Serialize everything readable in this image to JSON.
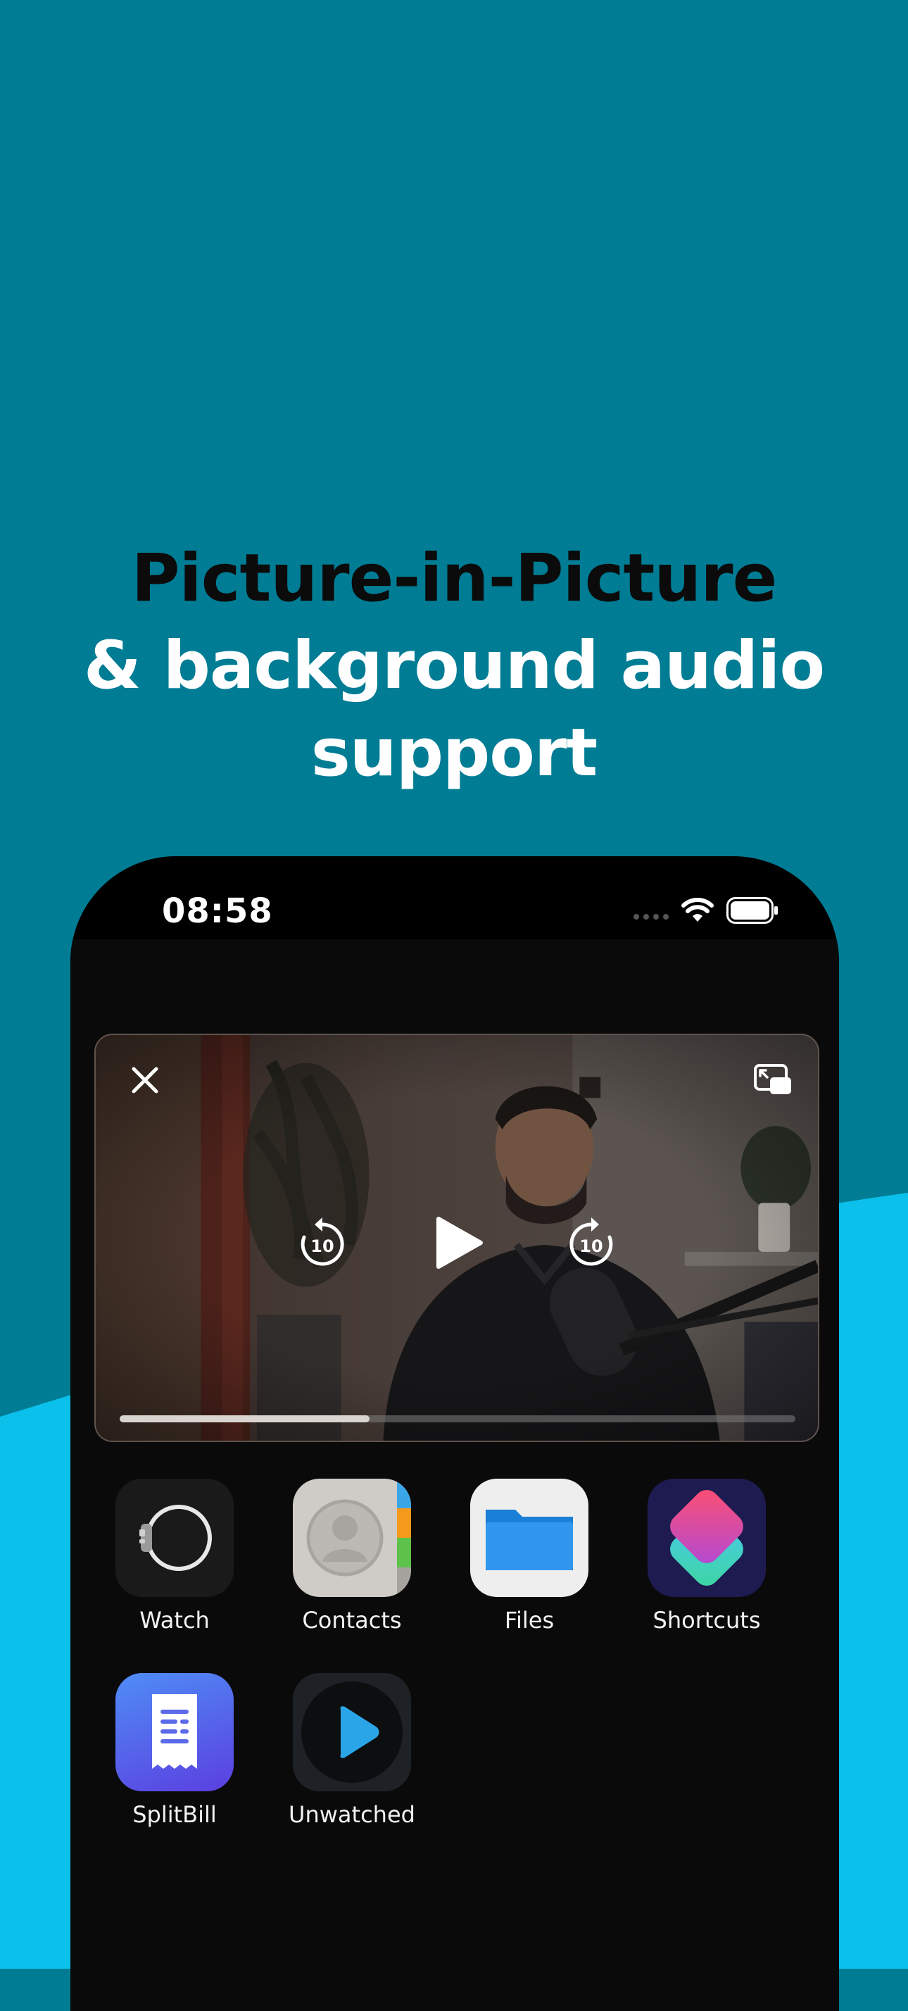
{
  "headline": {
    "line1": "Picture-in-Picture",
    "line2": "& background audio",
    "line3": "support"
  },
  "status_bar": {
    "time": "08:58",
    "icons": [
      "cellular-dots-icon",
      "wifi-icon",
      "battery-icon"
    ]
  },
  "player": {
    "controls": [
      "close-icon",
      "pip-restore-icon",
      "skip-back-10-icon",
      "play-icon",
      "skip-forward-10-icon"
    ],
    "skip_back_label": "10",
    "skip_forward_label": "10",
    "progress": 0.37
  },
  "apps": [
    {
      "label": "Watch",
      "icon": "watch-icon"
    },
    {
      "label": "Contacts",
      "icon": "contacts-icon"
    },
    {
      "label": "Files",
      "icon": "folder-icon"
    },
    {
      "label": "Shortcuts",
      "icon": "shortcuts-icon"
    },
    {
      "label": "SplitBill",
      "icon": "receipt-icon"
    },
    {
      "label": "Unwatched",
      "icon": "play-circle-icon"
    }
  ],
  "colors": {
    "background_top": "#007c94",
    "background_wave": "#0bc0ea",
    "phone_frame": "#000000"
  }
}
